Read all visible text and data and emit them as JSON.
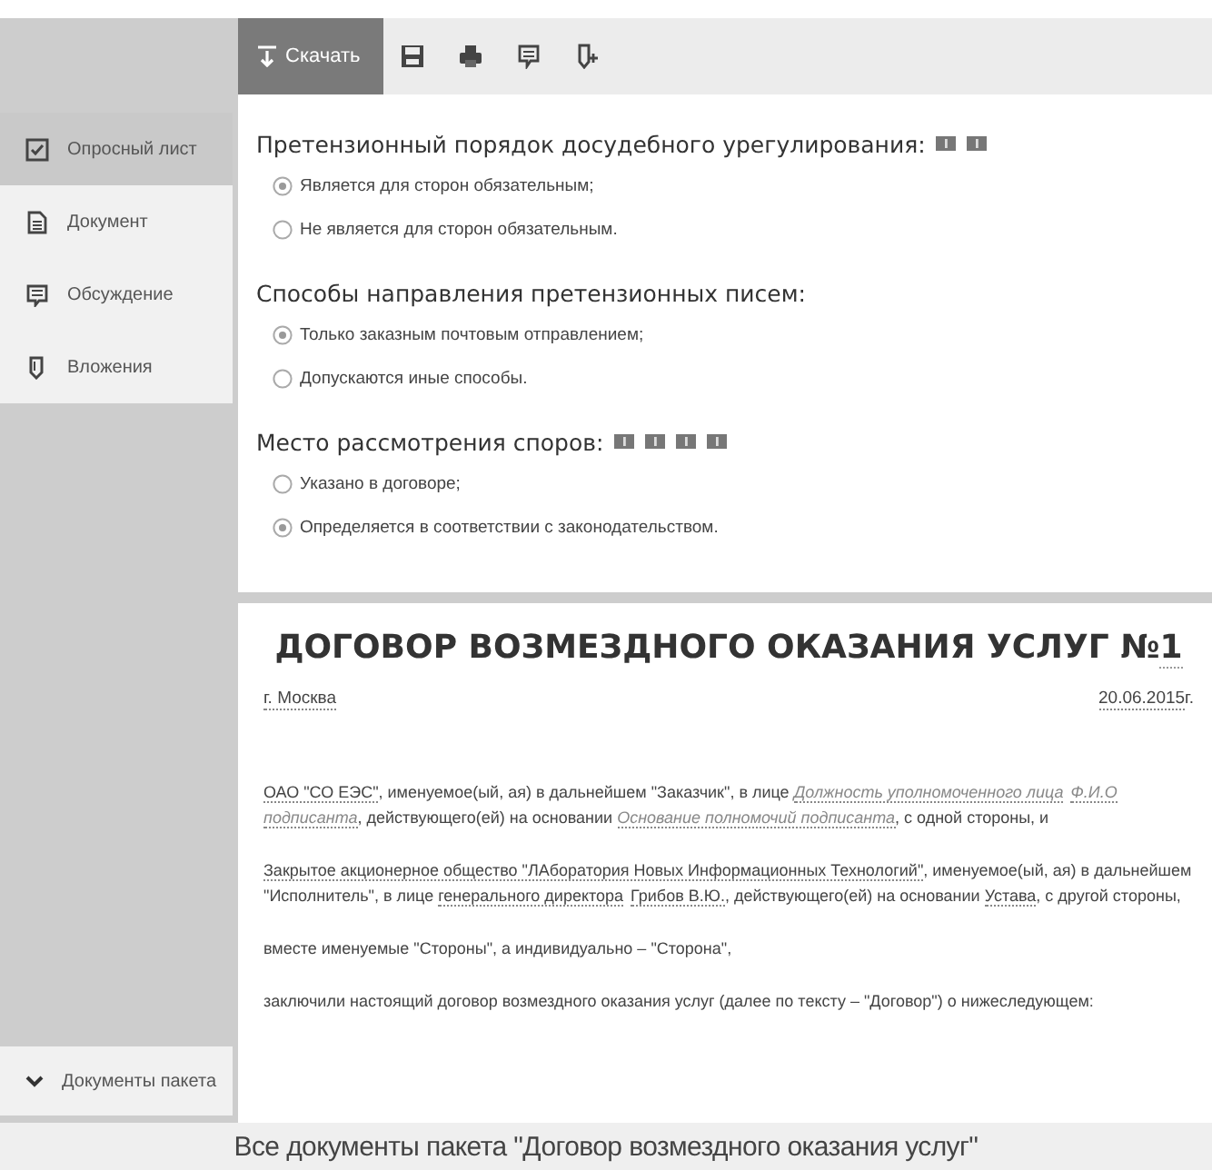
{
  "toolbar": {
    "download": {
      "label": "Скачать"
    },
    "tools": [
      {
        "kind": "save"
      },
      {
        "kind": "print"
      },
      {
        "kind": "comment"
      },
      {
        "kind": "export"
      }
    ]
  },
  "sidebar": {
    "items": [
      {
        "label": "Опросный лист",
        "kind": "checklist",
        "selected": true
      },
      {
        "label": "Документ",
        "kind": "document",
        "selected": false
      },
      {
        "label": "Обсуждение",
        "kind": "comment",
        "selected": false
      },
      {
        "label": "Вложения",
        "kind": "attachment",
        "selected": false
      }
    ],
    "package": {
      "label": "Документы пакета",
      "expanded": false
    }
  },
  "questions": [
    {
      "title": "Претензионный порядок досудебного урегулирования:",
      "hints": [
        {
          "kind": "info"
        },
        {
          "kind": "info"
        }
      ],
      "options": [
        {
          "label": "Является для сторон обязательным;",
          "selected": true
        },
        {
          "label": "Не является для сторон обязательным.",
          "selected": false
        }
      ]
    },
    {
      "title": "Способы направления претензионных писем:",
      "options": [
        {
          "label": "Только заказным почтовым отправлением;",
          "selected": true
        },
        {
          "label": "Допускаются иные способы.",
          "selected": false
        }
      ]
    },
    {
      "title": "Место рассмотрения споров:",
      "hints": [
        {
          "kind": "info"
        },
        {
          "kind": "info"
        },
        {
          "kind": "info"
        },
        {
          "kind": "info"
        }
      ],
      "options": [
        {
          "label": "Указано в договоре;",
          "selected": false
        },
        {
          "label": "Определяется в соответствии с законодательством.",
          "selected": true
        }
      ]
    }
  ],
  "document": {
    "title": "ДОГОВОР ВОЗМЕЗДНОГО ОКАЗАНИЯ УСЛУГ №",
    "number": "1",
    "city": "г. Москва",
    "date": "20.06.2015",
    "date_suffix": "г.",
    "paragraphs": [
      [
        {
          "kind": "field",
          "text": "ОАО \"СО ЕЭС\""
        },
        {
          "kind": "plain",
          "text": ", именуемое(ый, ая) в дальнейшем \"Заказчик\", в лице "
        },
        {
          "kind": "hint",
          "text": "Должность уполномоченного лица"
        },
        {
          "kind": "hint",
          "text": "Ф.И.О подписанта"
        },
        {
          "kind": "plain",
          "text": ", действующего(ей) на основании "
        },
        {
          "kind": "hint",
          "text": "Основание полномочий подписанта"
        },
        {
          "kind": "plain",
          "text": ", с одной стороны, и"
        }
      ],
      [
        {
          "kind": "field",
          "text": "Закрытое акционерное общество \"ЛАборатория Новых Информационных Технологий\""
        },
        {
          "kind": "plain",
          "text": ", именуемое(ый, ая) в дальнейшем \"Исполнитель\", в лице "
        },
        {
          "kind": "field",
          "text": "генерального директора"
        },
        {
          "kind": "field",
          "text": "Грибов В.Ю."
        },
        {
          "kind": "plain",
          "text": ", действующего(ей) на основании "
        },
        {
          "kind": "field",
          "text": "Устава"
        },
        {
          "kind": "plain",
          "text": ", с другой стороны,"
        }
      ],
      [
        {
          "kind": "plain",
          "text": "вместе именуемые \"Стороны\", а индивидуально – \"Сторона\","
        }
      ],
      [
        {
          "kind": "plain",
          "text": "заключили настоящий договор возмездного оказания услуг (далее по тексту – \"Договор\") о нижеследующем:"
        }
      ]
    ]
  },
  "footer": {
    "caption": "Все документы пакета \"Договор возмездного оказания услуг\""
  }
}
